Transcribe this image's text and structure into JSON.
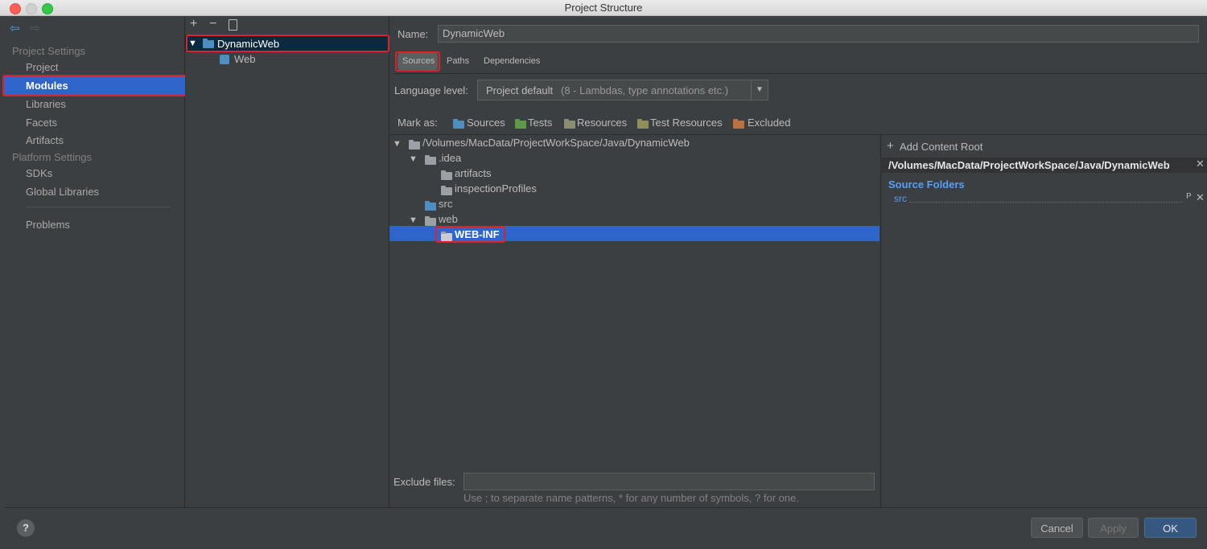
{
  "window": {
    "title": "Project Structure"
  },
  "left": {
    "project_settings": "Project Settings",
    "project": "Project",
    "modules": "Modules",
    "libraries": "Libraries",
    "facets": "Facets",
    "artifacts": "Artifacts",
    "platform_settings": "Platform Settings",
    "sdks": "SDKs",
    "global_libraries": "Global Libraries",
    "problems": "Problems"
  },
  "modules": {
    "toolbar": {
      "add": "+",
      "remove": "−"
    },
    "root": "DynamicWeb",
    "child": "Web"
  },
  "details": {
    "name_label": "Name:",
    "name_value": "DynamicWeb",
    "tabs": [
      "Sources",
      "Paths",
      "Dependencies"
    ],
    "language_label": "Language level:",
    "language_value": "Project default",
    "language_detail": "(8 - Lambdas, type annotations etc.)",
    "mark_as_label": "Mark as:",
    "mark_sources": "Sources",
    "mark_tests": "Tests",
    "mark_resources": "Resources",
    "mark_test_resources": "Test Resources",
    "mark_excluded": "Excluded",
    "tree": {
      "root": "/Volumes/MacData/ProjectWorkSpace/Java/DynamicWeb",
      "idea": ".idea",
      "artifacts": "artifacts",
      "inspection": "inspectionProfiles",
      "src": "src",
      "web": "web",
      "webinf": "WEB-INF"
    },
    "add_content_root": "Add Content Root",
    "content_root_path": "/Volumes/MacData/ProjectWorkSpace/Java/DynamicWeb",
    "source_folders_label": "Source Folders",
    "source_folder": "src",
    "exclude_label": "Exclude files:",
    "exclude_value": "",
    "exclude_hint": "Use ; to separate name patterns, * for any number of symbols, ? for one."
  },
  "buttons": {
    "help": "?",
    "cancel": "Cancel",
    "apply": "Apply",
    "ok": "OK"
  },
  "colors": {
    "background": "#3c3f41",
    "selection": "#2f65ca",
    "highlight_box": "#e0202a",
    "link": "#589df6"
  }
}
